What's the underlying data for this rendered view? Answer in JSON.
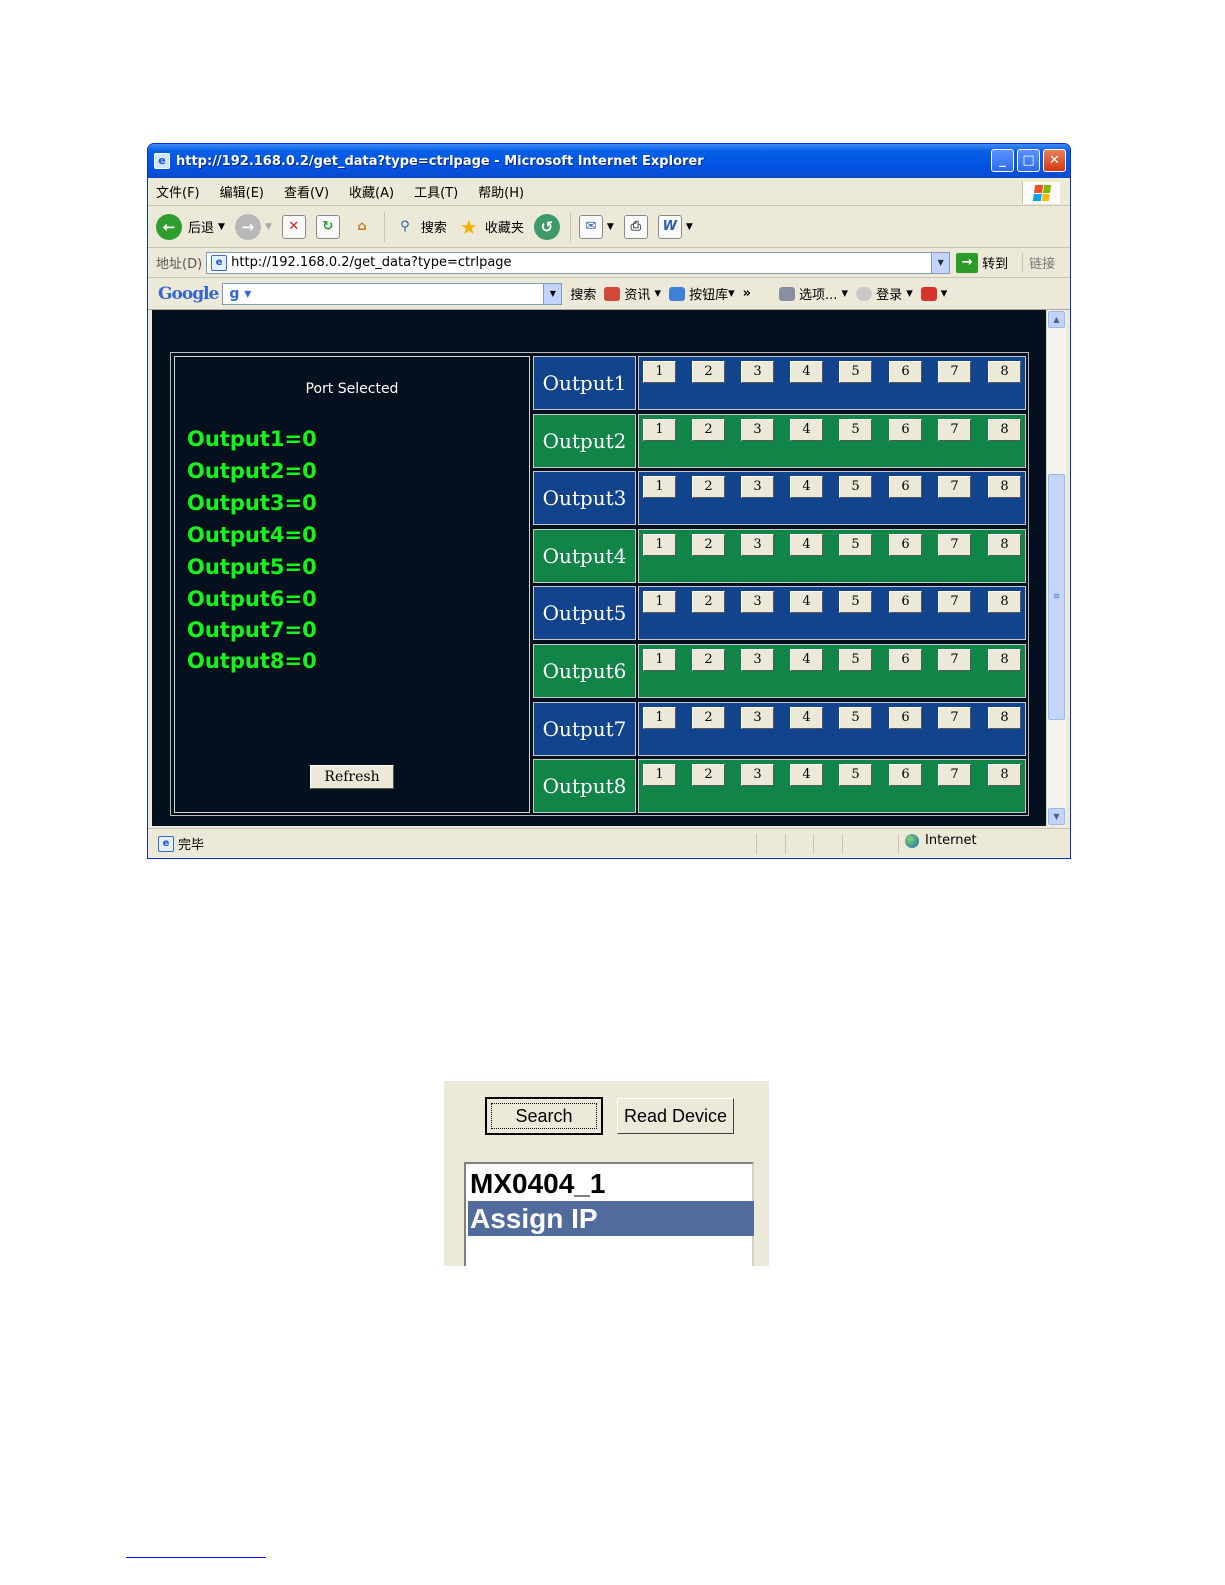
{
  "window": {
    "title": "http://192.168.0.2/get_data?type=ctrlpage - Microsoft Internet Explorer",
    "buttons": {
      "minimize": "_",
      "maximize": "□",
      "close": "✕"
    }
  },
  "menubar": [
    "文件(F)",
    "编辑(E)",
    "查看(V)",
    "收藏(A)",
    "工具(T)",
    "帮助(H)"
  ],
  "toolbar": {
    "back": "后退",
    "search": "搜索",
    "favorites": "收藏夹"
  },
  "addressbar": {
    "label": "地址(D)",
    "url": "http://192.168.0.2/get_data?type=ctrlpage",
    "go": "转到",
    "links": "链接"
  },
  "googlebar": {
    "logo": "Google",
    "search": "搜索",
    "news": "资讯",
    "buttons": "按钮库",
    "more": "»",
    "options": "选项...",
    "login": "登录"
  },
  "statusbar": {
    "text": "完毕",
    "zone": "Internet"
  },
  "ctrlpage": {
    "port_selected_title": "Port Selected",
    "status_lines": [
      "Output1=0",
      "Output2=0",
      "Output3=0",
      "Output4=0",
      "Output5=0",
      "Output6=0",
      "Output7=0",
      "Output8=0"
    ],
    "refresh_label": "Refresh",
    "outputs": [
      "Output1",
      "Output2",
      "Output3",
      "Output4",
      "Output5",
      "Output6",
      "Output7",
      "Output8"
    ],
    "input_buttons": [
      "1",
      "2",
      "3",
      "4",
      "5",
      "6",
      "7",
      "8"
    ],
    "row_colors": [
      "#12448e",
      "#118447"
    ]
  },
  "device_dialog": {
    "search_label": "Search",
    "read_device_label": "Read Device",
    "list_items": [
      "MX0404_1",
      "Assign IP"
    ],
    "selected_index": 1
  }
}
